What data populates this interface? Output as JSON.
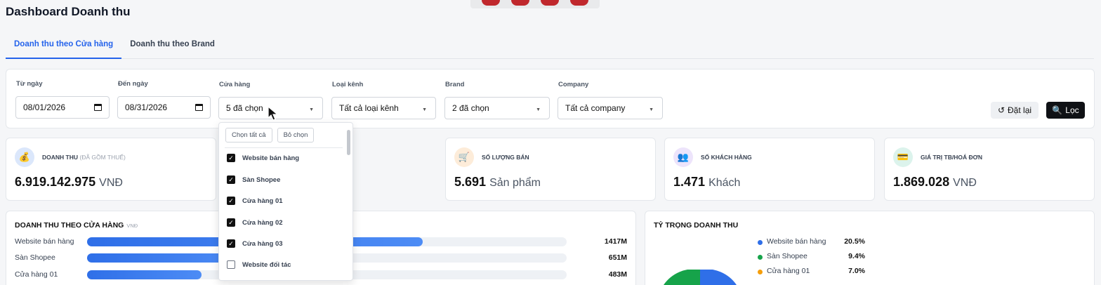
{
  "page": {
    "title": "Dashboard Doanh thu"
  },
  "tabs": [
    {
      "label": "Doanh thu theo Cửa hàng",
      "active": true
    },
    {
      "label": "Doanh thu theo Brand",
      "active": false
    }
  ],
  "filters": {
    "from_date": {
      "label": "Từ ngày",
      "value": "08/01/2026"
    },
    "to_date": {
      "label": "Đến ngày",
      "value": "08/31/2026"
    },
    "store": {
      "label": "Cửa hàng",
      "value": "5 đã chọn"
    },
    "channel": {
      "label": "Loại kênh",
      "value": "Tất cả loại kênh"
    },
    "brand": {
      "label": "Brand",
      "value": "2 đã chọn"
    },
    "company": {
      "label": "Company",
      "value": "Tất cả company"
    },
    "reset_label": "Đặt lại",
    "filter_label": "Lọc"
  },
  "kpis": {
    "revenue": {
      "icon": "money-bag-icon",
      "label": "DOANH THU",
      "note": "(ĐÃ GỒM THUẾ)",
      "value": "6.919.142.975",
      "unit": "VNĐ"
    },
    "quantity": {
      "icon": "cart-icon",
      "label": "SỐ LƯỢNG BÁN",
      "value": "5.691",
      "unit": "Sản phẩm"
    },
    "customers": {
      "icon": "users-icon",
      "label": "SỐ KHÁCH HÀNG",
      "value": "1.471",
      "unit": "Khách"
    },
    "avg_order": {
      "icon": "card-icon",
      "label": "GIÁ TRỊ TB/HOÁ ĐƠN",
      "value": "1.869.028",
      "unit": "VNĐ"
    }
  },
  "store_revenue": {
    "title": "DOANH THU THEO CỬA HÀNG",
    "unit": "VNĐ",
    "rows": [
      {
        "name": "Website bán hàng",
        "amount": "1417M",
        "value": 1417
      },
      {
        "name": "Sàn Shopee",
        "amount": "651M",
        "value": 651
      },
      {
        "name": "Cửa hàng 01",
        "amount": "483M",
        "value": 483
      }
    ]
  },
  "share": {
    "title": "TỶ TRỌNG DOANH THU",
    "legend": [
      {
        "name": "Website bán hàng",
        "pct": "20.5%",
        "color": "#2f6fe8"
      },
      {
        "name": "Sàn Shopee",
        "pct": "9.4%",
        "color": "#16a34a"
      },
      {
        "name": "Cửa hàng 01",
        "pct": "7.0%",
        "color": "#f59e0b"
      }
    ]
  },
  "store_dropdown": {
    "select_all": "Chọn tất cả",
    "deselect": "Bỏ chọn",
    "options": [
      {
        "label": "Website bán hàng",
        "checked": true
      },
      {
        "label": "Sàn Shopee",
        "checked": true
      },
      {
        "label": "Cửa hàng 01",
        "checked": true
      },
      {
        "label": "Cửa hàng 02",
        "checked": true
      },
      {
        "label": "Cửa hàng 03",
        "checked": true
      },
      {
        "label": "Website đối tác",
        "checked": false
      }
    ]
  }
}
